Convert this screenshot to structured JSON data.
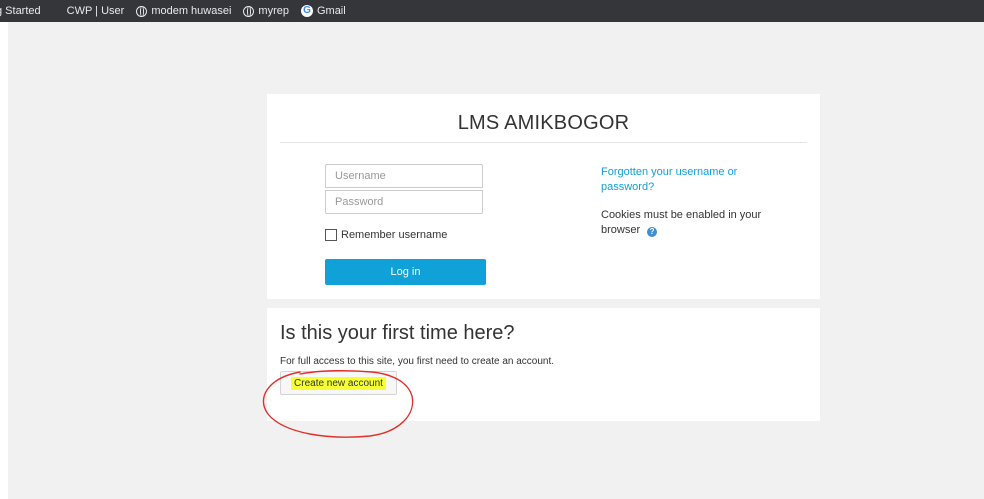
{
  "bookmarks": [
    {
      "label": "g Started",
      "icon": "none"
    },
    {
      "label": "CWP | User",
      "icon": "none"
    },
    {
      "label": "modem huwasei",
      "icon": "globe-icon"
    },
    {
      "label": "myrep",
      "icon": "globe-icon"
    },
    {
      "label": "Gmail",
      "icon": "google-icon"
    }
  ],
  "login": {
    "site_name": "LMS AMIKBOGOR",
    "username_placeholder": "Username",
    "password_placeholder": "Password",
    "remember_label": "Remember username",
    "login_button": "Log in",
    "forgot_link": "Forgotten your username or password?",
    "cookies_notice": "Cookies must be enabled in your browser"
  },
  "signup": {
    "heading": "Is this your first time here?",
    "description": "For full access to this site, you first need to create an account.",
    "create_button": "Create new account"
  },
  "colors": {
    "accent": "#0fa1d8",
    "highlight": "#f6ff33",
    "annotation": "#e0302a"
  }
}
